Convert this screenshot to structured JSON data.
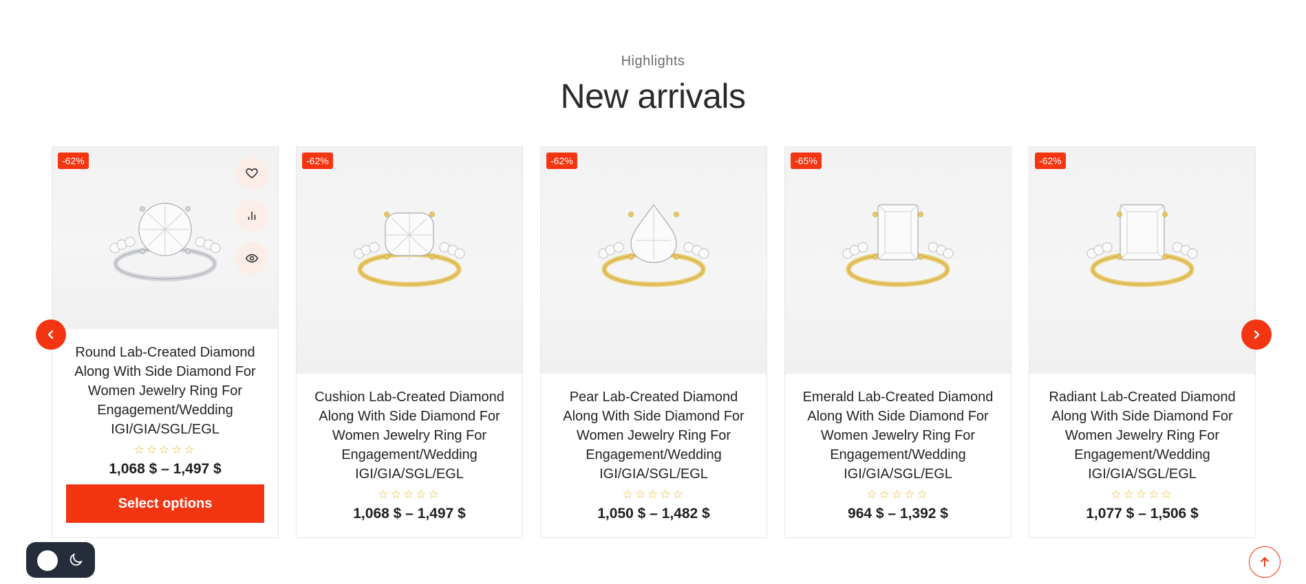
{
  "section": {
    "kicker": "Highlights",
    "title": "New arrivals"
  },
  "products": [
    {
      "badge": "-62%",
      "name": "Round Lab-Created Diamond Along With Side Diamond For Women Jewelry Ring For Engagement/Wedding IGI/GIA/SGL/EGL",
      "stars": "☆☆☆☆☆",
      "price": "1,068 $ – 1,497 $",
      "metal": "silver",
      "shape": "round",
      "button": "Select options"
    },
    {
      "badge": "-62%",
      "name": "Cushion Lab-Created Diamond Along With Side Diamond For Women Jewelry Ring For Engagement/Wedding IGI/GIA/SGL/EGL",
      "stars": "☆☆☆☆☆",
      "price": "1,068 $ – 1,497 $",
      "metal": "gold",
      "shape": "cushion"
    },
    {
      "badge": "-62%",
      "name": "Pear Lab-Created Diamond Along With Side Diamond For Women Jewelry Ring For Engagement/Wedding IGI/GIA/SGL/EGL",
      "stars": "☆☆☆☆☆",
      "price": "1,050 $ – 1,482 $",
      "metal": "gold",
      "shape": "pear"
    },
    {
      "badge": "-65%",
      "name": "Emerald Lab-Created Diamond Along With Side Diamond For Women Jewelry Ring For Engagement/Wedding IGI/GIA/SGL/EGL",
      "stars": "☆☆☆☆☆",
      "price": "964 $ – 1,392 $",
      "metal": "gold",
      "shape": "emerald"
    },
    {
      "badge": "-62%",
      "name": "Radiant Lab-Created Diamond Along With Side Diamond For Women Jewelry Ring For Engagement/Wedding IGI/GIA/SGL/EGL",
      "stars": "☆☆☆☆☆",
      "price": "1,077 $ – 1,506 $",
      "metal": "gold",
      "shape": "radiant"
    }
  ],
  "icons": {
    "wishlist": "heart-icon",
    "compare": "bar-chart-icon",
    "quick_view": "eye-icon",
    "prev": "chevron-left-icon",
    "next": "chevron-right-icon",
    "theme": "moon-icon",
    "back_to_top": "arrow-up-icon"
  },
  "colors": {
    "accent": "#f33512",
    "stars": "#e7b21a",
    "toggle_bg": "#262d3a",
    "gold": "#e8c96a",
    "silver": "#d4d6da"
  }
}
